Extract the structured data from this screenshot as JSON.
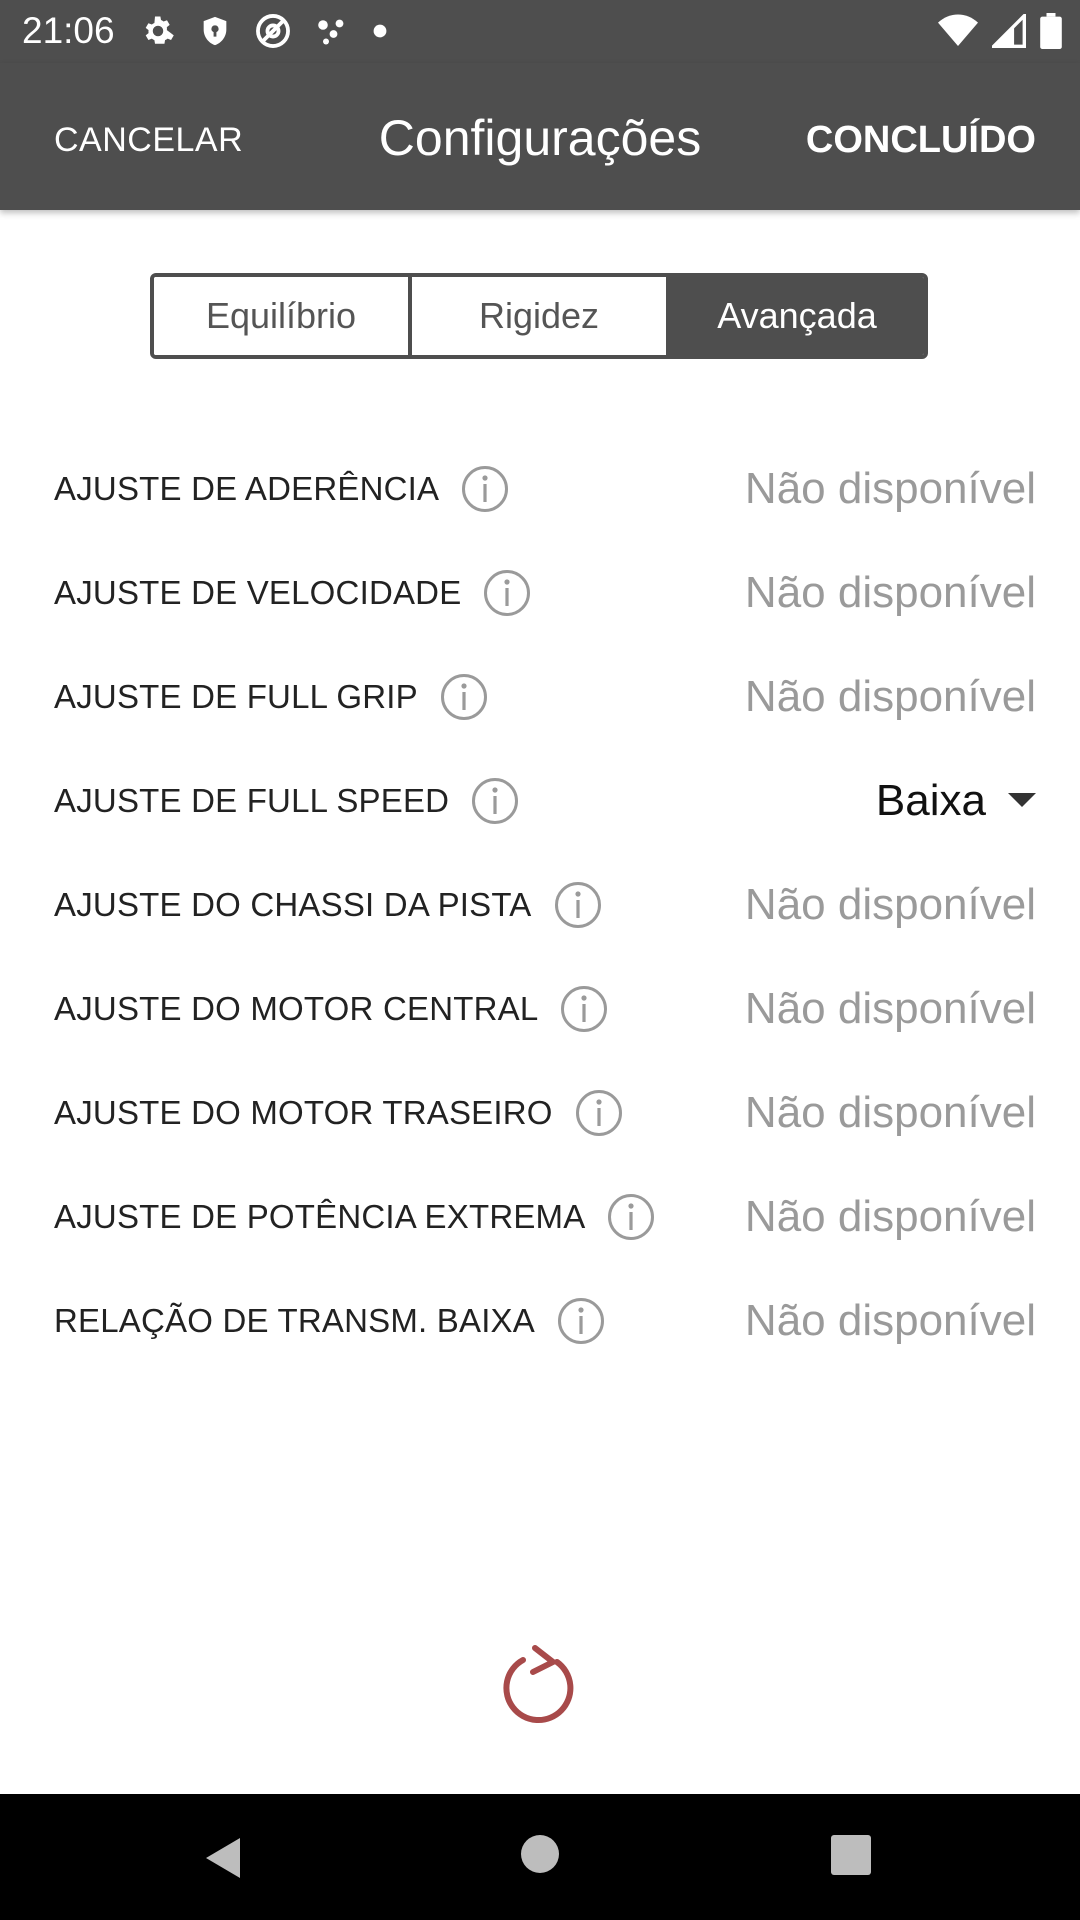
{
  "status_bar": {
    "time": "21:06",
    "left_icons": [
      "settings-gear-icon",
      "shield-icon",
      "at-sign-icon",
      "dots-cluster-icon",
      "small-dot-icon"
    ],
    "right_icons": [
      "wifi-icon",
      "cell-signal-icon",
      "battery-icon"
    ]
  },
  "app_bar": {
    "cancel_label": "CANCELAR",
    "title": "Configurações",
    "done_label": "CONCLUÍDO"
  },
  "tabs": [
    {
      "label": "Equilíbrio",
      "active": false
    },
    {
      "label": "Rigidez",
      "active": false
    },
    {
      "label": "Avançada",
      "active": true
    }
  ],
  "settings": [
    {
      "label": "AJUSTE DE ADERÊNCIA",
      "value": "Não disponível"
    },
    {
      "label": "AJUSTE DE VELOCIDADE",
      "value": "Não disponível"
    },
    {
      "label": "AJUSTE DE FULL GRIP",
      "value": "Não disponível"
    },
    {
      "label": "AJUSTE DE FULL SPEED",
      "value": "Baixa",
      "dropdown": true
    },
    {
      "label": "AJUSTE DO CHASSI DA PISTA",
      "value": "Não disponível"
    },
    {
      "label": "AJUSTE DO MOTOR CENTRAL",
      "value": "Não disponível"
    },
    {
      "label": "AJUSTE DO MOTOR TRASEIRO",
      "value": "Não disponível"
    },
    {
      "label": "AJUSTE DE POTÊNCIA EXTREMA",
      "value": "Não disponível"
    },
    {
      "label": "RELAÇÃO DE TRANSM. BAIXA",
      "value": "Não disponível"
    }
  ],
  "colors": {
    "app_bar": "#4e4e4e",
    "refresh_icon": "#a84a4a",
    "unavailable_text": "#9a9a9a"
  }
}
